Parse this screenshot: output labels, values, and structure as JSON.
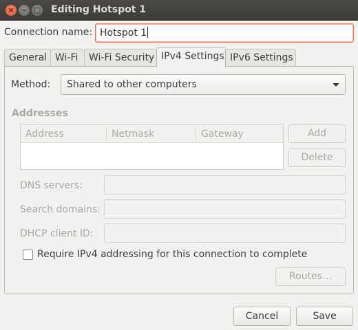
{
  "window": {
    "title": "Editing Hotspot 1"
  },
  "connection": {
    "label": "Connection name:",
    "value": "Hotspot 1"
  },
  "tabs": [
    {
      "label": "General"
    },
    {
      "label": "Wi-Fi"
    },
    {
      "label": "Wi-Fi Security"
    },
    {
      "label": "IPv4 Settings",
      "active": true
    },
    {
      "label": "IPv6 Settings"
    }
  ],
  "method": {
    "label": "Method:",
    "value": "Shared to other computers"
  },
  "addresses": {
    "title": "Addresses",
    "columns": [
      "Address",
      "Netmask",
      "Gateway"
    ],
    "rows": [],
    "add_label": "Add",
    "delete_label": "Delete"
  },
  "fields": {
    "dns_label": "DNS servers:",
    "search_label": "Search domains:",
    "dhcp_label": "DHCP client ID:",
    "dns_value": "",
    "search_value": "",
    "dhcp_value": ""
  },
  "require_ipv4": {
    "label": "Require IPv4 addressing for this connection to complete",
    "checked": false
  },
  "routes_label": "Routes…",
  "buttons": {
    "cancel": "Cancel",
    "save": "Save"
  },
  "colors": {
    "accent": "#e9794c",
    "close_button": "#e25a33",
    "titlebar": "#3c3b37"
  },
  "icons": {
    "close": "close-icon",
    "minimize": "minimize-icon",
    "maximize": "maximize-icon",
    "dropdown": "chevron-down-icon"
  }
}
